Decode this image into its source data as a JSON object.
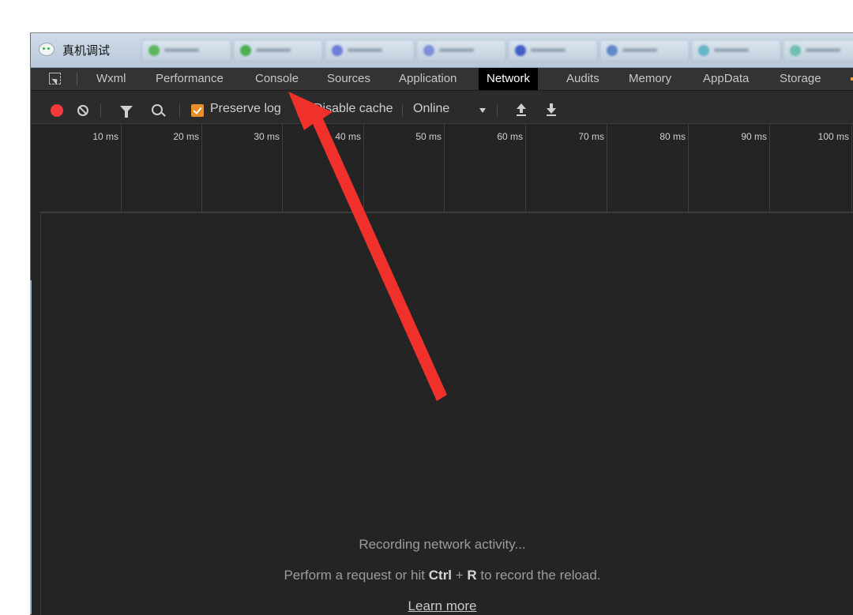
{
  "window": {
    "title": "真机调试"
  },
  "panel_tabs": [
    {
      "label": "Wxml"
    },
    {
      "label": "Performance"
    },
    {
      "label": "Console"
    },
    {
      "label": "Sources"
    },
    {
      "label": "Application"
    },
    {
      "label": "Network",
      "active": true
    },
    {
      "label": "Audits"
    },
    {
      "label": "Memory"
    },
    {
      "label": "AppData"
    },
    {
      "label": "Storage"
    }
  ],
  "toolbar": {
    "preserve_log": {
      "label": "Preserve log",
      "checked": true
    },
    "disable_cache": {
      "label": "Disable cache",
      "checked": false
    },
    "throttling": {
      "selected": "Online"
    }
  },
  "timeline": {
    "ticks": [
      "10 ms",
      "20 ms",
      "30 ms",
      "40 ms",
      "50 ms",
      "60 ms",
      "70 ms",
      "80 ms",
      "90 ms",
      "100 ms"
    ]
  },
  "empty_state": {
    "line1": "Recording network activity...",
    "line2_pre": "Perform a request or hit ",
    "line2_key1": "Ctrl",
    "line2_plus": " + ",
    "line2_key2": "R",
    "line2_post": " to record the reload.",
    "link": "Learn more"
  },
  "colors": {
    "record": "#f33b3b",
    "checkbox": "#e88f2a",
    "annotation_arrow": "#f0302a",
    "panel_bg": "#242424"
  },
  "icons": [
    "wechat-icon",
    "inspect-icon",
    "record-icon",
    "clear-icon",
    "filter-icon",
    "search-icon",
    "upload-icon",
    "download-icon"
  ]
}
